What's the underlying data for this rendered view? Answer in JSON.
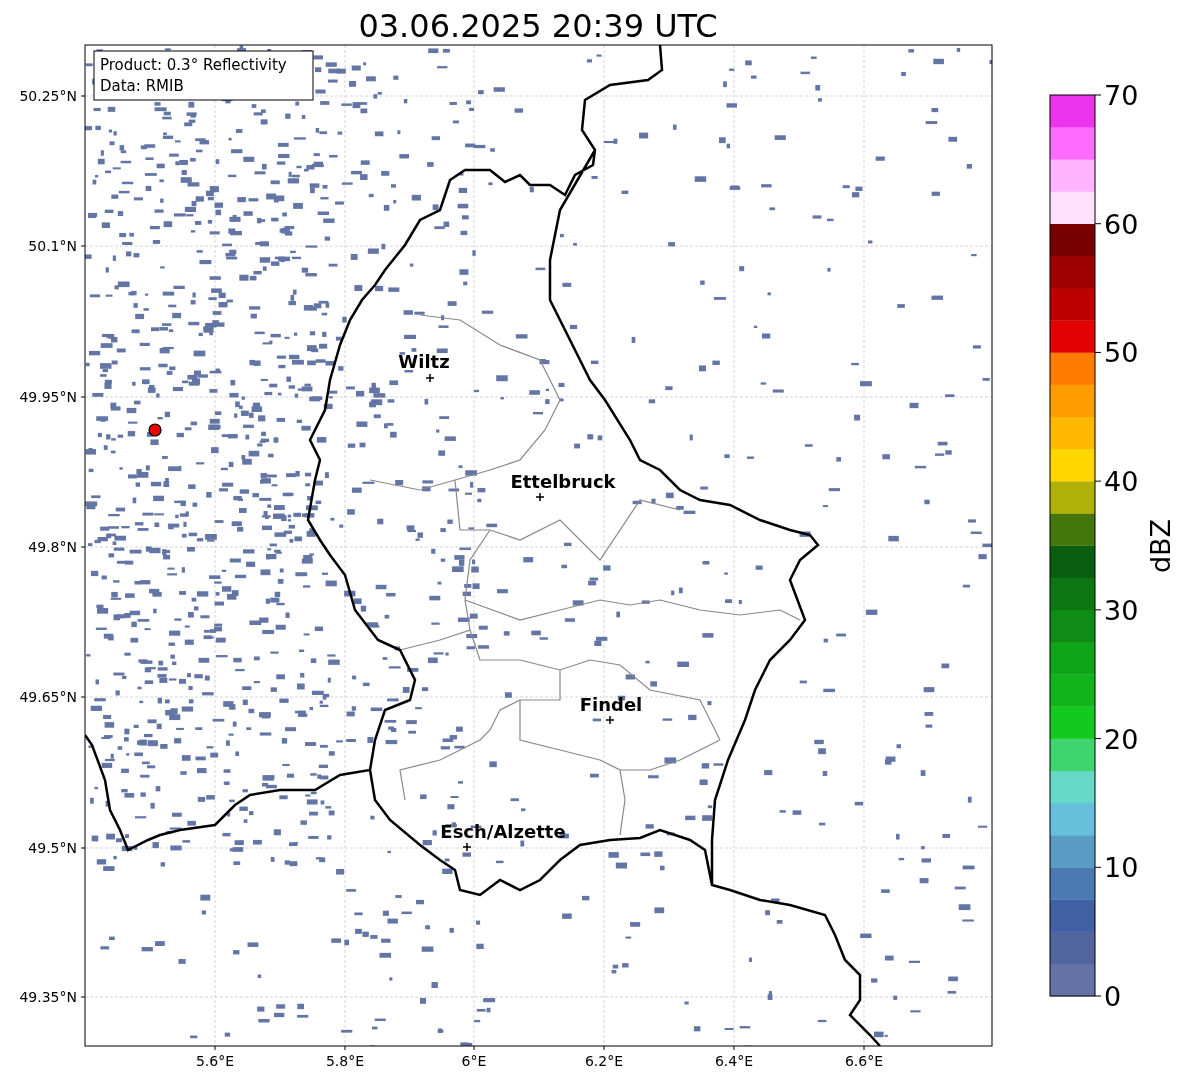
{
  "title": "03.06.2025 20:39 UTC",
  "info": [
    "Product: 0.3° Reflectivity",
    "Data: RMIB"
  ],
  "map": {
    "xticks": [
      "5.6°E",
      "5.8°E",
      "6°E",
      "6.2°E",
      "6.4°E",
      "6.6°E"
    ],
    "yticks": [
      "50.25°N",
      "50.1°N",
      "49.95°N",
      "49.8°N",
      "49.65°N",
      "49.5°N",
      "49.35°N"
    ],
    "cities": [
      {
        "name": "Wiltz"
      },
      {
        "name": "Ettelbruck"
      },
      {
        "name": "Findel"
      },
      {
        "name": "Esch/Alzette"
      }
    ]
  },
  "colorbar": {
    "label": "dBZ",
    "ticks": [
      "70",
      "60",
      "50",
      "40",
      "30",
      "20",
      "10",
      "0"
    ],
    "bands": [
      {
        "color": "#6473a6"
      },
      {
        "color": "#52669e"
      },
      {
        "color": "#4160a4"
      },
      {
        "color": "#4b7ab0"
      },
      {
        "color": "#5a9cc4"
      },
      {
        "color": "#66c0dc"
      },
      {
        "color": "#66d8c8"
      },
      {
        "color": "#3ed46e"
      },
      {
        "color": "#14c81e"
      },
      {
        "color": "#12b41c"
      },
      {
        "color": "#10a418"
      },
      {
        "color": "#0f8c15"
      },
      {
        "color": "#0c7612"
      },
      {
        "color": "#0a5e10"
      },
      {
        "color": "#44760c"
      },
      {
        "color": "#b0b008"
      },
      {
        "color": "#ffd600"
      },
      {
        "color": "#ffb800"
      },
      {
        "color": "#ff9c00"
      },
      {
        "color": "#ff7c00"
      },
      {
        "color": "#e20000"
      },
      {
        "color": "#bc0000"
      },
      {
        "color": "#9c0000"
      },
      {
        "color": "#780000"
      },
      {
        "color": "#ffe0ff"
      },
      {
        "color": "#ffb4ff"
      },
      {
        "color": "#ff6cff"
      },
      {
        "color": "#ec34ec"
      }
    ]
  }
}
